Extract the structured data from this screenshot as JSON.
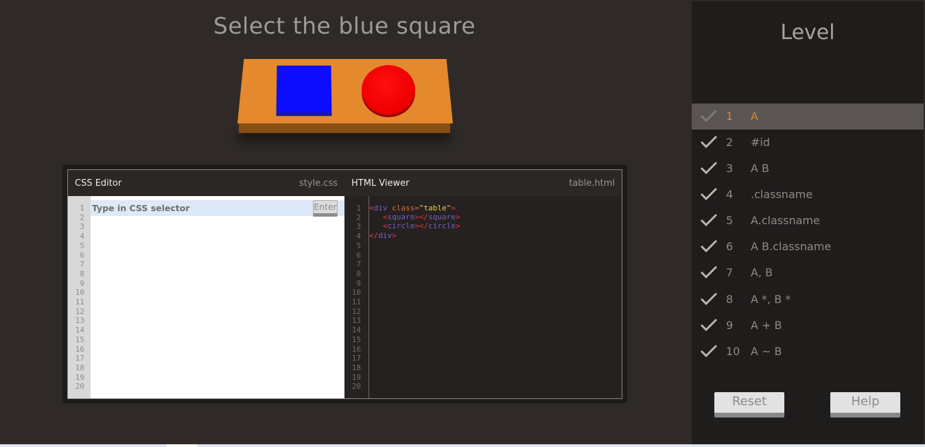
{
  "title": "Select the blue square",
  "scene": {
    "table": "table",
    "items": [
      "square",
      "circle"
    ],
    "colors": {
      "table": "#e5892f",
      "square": "#0c0cff",
      "circle": "#f00000"
    }
  },
  "css_editor": {
    "label": "CSS Editor",
    "file": "style.css",
    "placeholder": "Type in CSS selector",
    "enter_label": "Enter",
    "line_numbers": "1\n2\n3\n4\n5\n6\n7\n8\n9\n10\n11\n12\n13\n14\n15\n16\n17\n18\n19\n20"
  },
  "html_viewer": {
    "label": "HTML Viewer",
    "file": "table.html",
    "line_numbers": "1\n2\n3\n4\n5\n6\n7\n8\n9\n10\n11\n12\n13\n14\n15\n16\n17\n18\n19\n20",
    "code": {
      "open_div_tag": "div",
      "class_attr": "class=",
      "class_val": "\"table\"",
      "square_tag": "square",
      "circle_tag": "circle",
      "close_div_tag": "div"
    }
  },
  "sidebar": {
    "title": "Level",
    "levels": [
      {
        "num": "1",
        "name": "A",
        "active": true
      },
      {
        "num": "2",
        "name": "#id"
      },
      {
        "num": "3",
        "name": "A B"
      },
      {
        "num": "4",
        "name": ".classname"
      },
      {
        "num": "5",
        "name": "A.classname"
      },
      {
        "num": "6",
        "name": "A B.classname"
      },
      {
        "num": "7",
        "name": "A, B"
      },
      {
        "num": "8",
        "name": "A *, B *"
      },
      {
        "num": "9",
        "name": "A + B"
      },
      {
        "num": "10",
        "name": " A ~ B"
      }
    ],
    "reset_label": "Reset",
    "help_label": "Help"
  }
}
